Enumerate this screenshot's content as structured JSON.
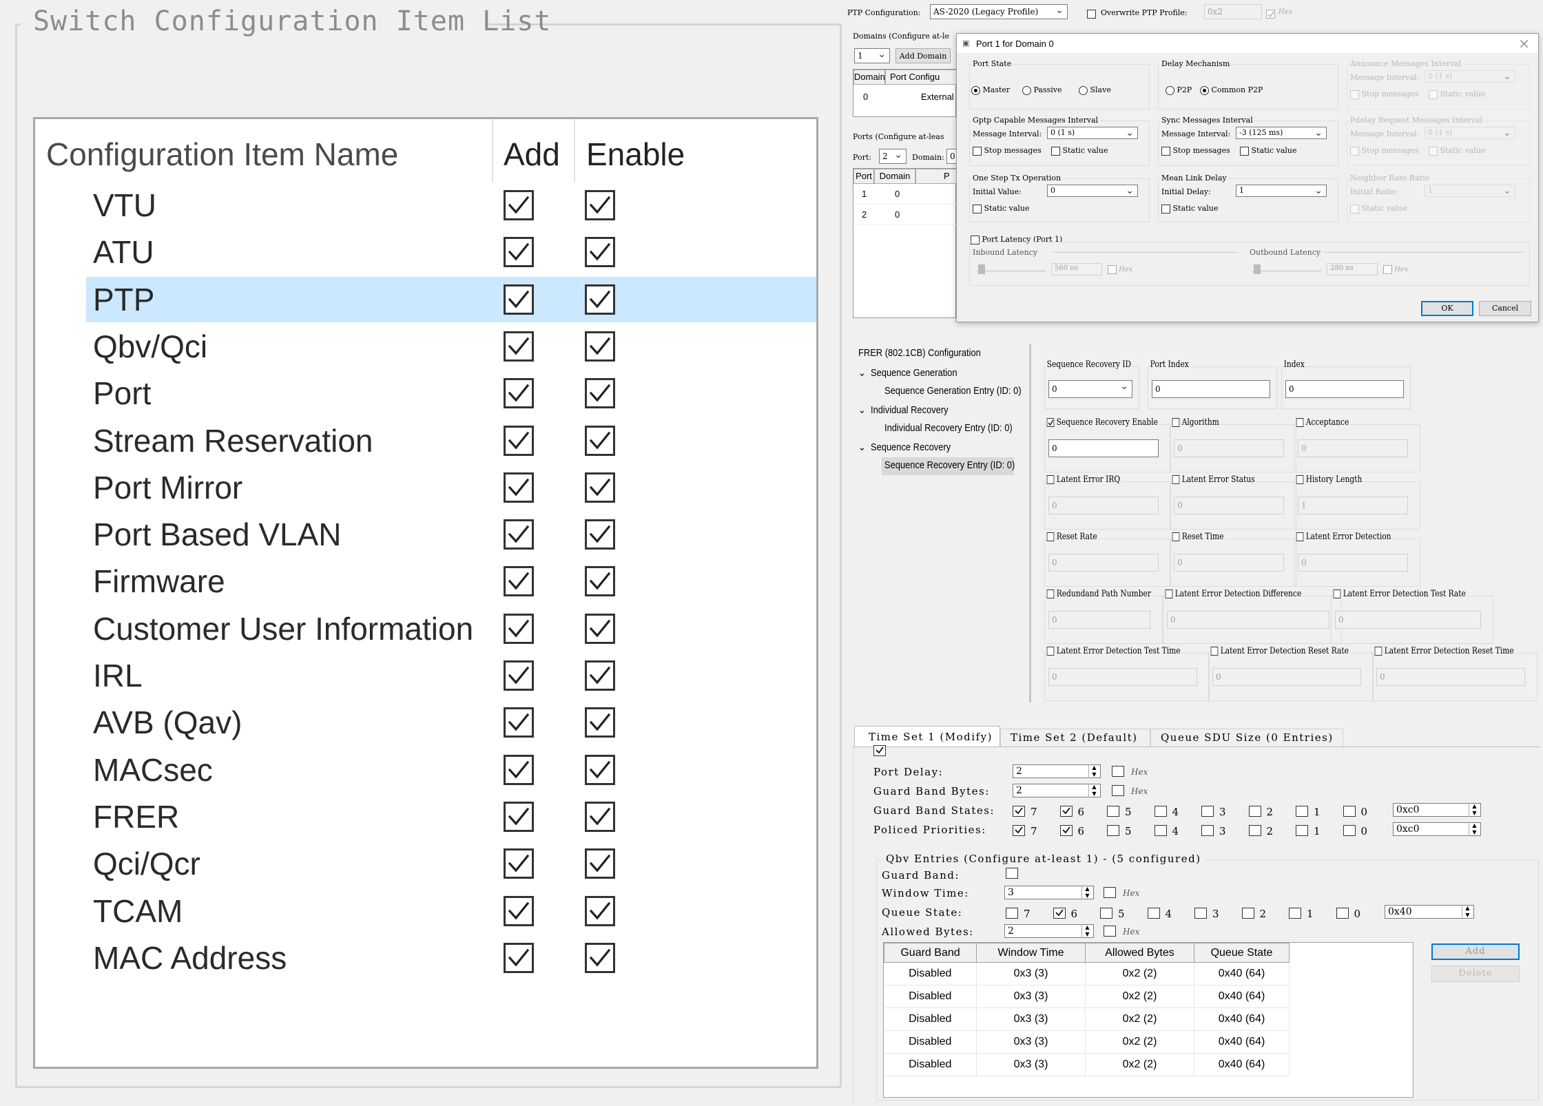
{
  "left": {
    "title": "Switch Configuration Item List",
    "headers": {
      "name": "Configuration Item Name",
      "add": "Add",
      "enable": "Enable"
    },
    "items": [
      {
        "label": "VTU",
        "add": true,
        "enable": true
      },
      {
        "label": "ATU",
        "add": true,
        "enable": true
      },
      {
        "label": "PTP",
        "add": true,
        "enable": true,
        "selected": true
      },
      {
        "label": "Qbv/Qci",
        "add": true,
        "enable": true
      },
      {
        "label": "Port",
        "add": true,
        "enable": true
      },
      {
        "label": "Stream Reservation",
        "add": true,
        "enable": true
      },
      {
        "label": "Port Mirror",
        "add": true,
        "enable": true
      },
      {
        "label": "Port Based VLAN",
        "add": true,
        "enable": true
      },
      {
        "label": "Firmware",
        "add": true,
        "enable": true
      },
      {
        "label": "Customer User Information",
        "add": true,
        "enable": true
      },
      {
        "label": "IRL",
        "add": true,
        "enable": true
      },
      {
        "label": "AVB (Qav)",
        "add": true,
        "enable": true
      },
      {
        "label": "MACsec",
        "add": true,
        "enable": true
      },
      {
        "label": "FRER",
        "add": true,
        "enable": true
      },
      {
        "label": "Qci/Qcr",
        "add": true,
        "enable": true
      },
      {
        "label": "TCAM",
        "add": true,
        "enable": true
      },
      {
        "label": "MAC Address",
        "add": true,
        "enable": true
      }
    ]
  },
  "ptp": {
    "config_label": "PTP Configuration:",
    "config_value": "AS-2020 (Legacy Profile)",
    "overwrite_label": "Overwrite PTP Profile:",
    "overwrite_value": "0x2",
    "hex_label": "Hex",
    "domains_label": "Domains (Configure at-le",
    "domain_select": "1",
    "add_domain": "Add Domain",
    "domain_table": {
      "headers": [
        "Domain",
        "Port Configu"
      ],
      "rows": [
        [
          "0",
          "External"
        ]
      ]
    },
    "ports_label": "Ports (Configure at-leas",
    "port_label": "Port:",
    "port_value": "2",
    "domain_lbl": "Domain:",
    "domain_value": "0",
    "port_table": {
      "headers": [
        "Port",
        "Domain",
        "P"
      ],
      "rows": [
        [
          "1",
          "0"
        ],
        [
          "2",
          "0"
        ]
      ]
    }
  },
  "dialog": {
    "title": "Port 1 for Domain 0",
    "close": "×",
    "port_state": {
      "title": "Port State",
      "options": [
        "Master",
        "Passive",
        "Slave"
      ],
      "selected": "Master"
    },
    "delay_mech": {
      "title": "Delay Mechanism",
      "options": [
        "P2P",
        "Common P2P"
      ],
      "selected": "Common P2P"
    },
    "announce": {
      "title": "Announce Messages Interval",
      "label": "Message Interval:",
      "value": "0 (1 s)",
      "stop": "Stop messages",
      "static": "Static value"
    },
    "gptp": {
      "title": "Gptp Capable Messages Interval",
      "label": "Message Interval:",
      "value": "0 (1 s)",
      "stop": "Stop messages",
      "static": "Static value"
    },
    "sync": {
      "title": "Sync Messages Interval",
      "label": "Message Interval:",
      "value": "-3 (125 ms)",
      "stop": "Stop messages",
      "static": "Static value"
    },
    "pdelay": {
      "title": "Pdelay Request Messages Interval",
      "label": "Message Interval:",
      "value": "0 (1 s)",
      "stop": "Stop messages",
      "static": "Static value"
    },
    "onestep": {
      "title": "One Step Tx Operation",
      "label": "Initial Value:",
      "value": "0",
      "static": "Static value"
    },
    "meanlink": {
      "title": "Mean Link Delay",
      "label": "Initial Delay:",
      "value": "1",
      "static": "Static value"
    },
    "neighbor": {
      "title": "Neighbor Rate Ratio",
      "label": "Initial Ratio:",
      "value": "1",
      "static": "Static value"
    },
    "latency": {
      "title": "Port Latency (Port 1)",
      "inbound": "Inbound Latency",
      "inbound_value": "560 ns",
      "outbound": "Outbound Latency",
      "outbound_value": "280 ns",
      "hex": "Hex"
    },
    "ok": "OK",
    "cancel": "Cancel"
  },
  "frer": {
    "tree": {
      "root": "FRER (802.1CB) Configuration",
      "nodes": [
        {
          "label": "Sequence Generation",
          "child": "Sequence Generation Entry (ID: 0)"
        },
        {
          "label": "Individual Recovery",
          "child": "Individual Recovery Entry (ID: 0)"
        },
        {
          "label": "Sequence Recovery",
          "child": "Sequence Recovery Entry (ID: 0)"
        }
      ]
    },
    "seq_recovery_id": {
      "label": "Sequence Recovery ID",
      "value": "0"
    },
    "port_index": {
      "label": "Port Index",
      "value": "0"
    },
    "index": {
      "label": "Index",
      "value": "0"
    },
    "fields": [
      {
        "label": "Sequence Recovery Enable",
        "value": "0",
        "checked": true,
        "enabled": true
      },
      {
        "label": "Algorithm",
        "value": "0",
        "checked": false
      },
      {
        "label": "Acceptance",
        "value": "0",
        "checked": false
      },
      {
        "label": "Latent Error IRQ",
        "value": "0",
        "checked": false
      },
      {
        "label": "Latent Error Status",
        "value": "0",
        "checked": false
      },
      {
        "label": "History Length",
        "value": "1",
        "checked": false
      },
      {
        "label": "Reset Rate",
        "value": "0",
        "checked": false
      },
      {
        "label": "Reset Time",
        "value": "0",
        "checked": false
      },
      {
        "label": "Latent Error Detection",
        "value": "0",
        "checked": false
      },
      {
        "label": "Redundand Path Number",
        "value": "0",
        "checked": false
      },
      {
        "label": "Latent Error Detection Difference",
        "value": "0",
        "checked": false
      },
      {
        "label": "Latent Error Detection Test Rate",
        "value": "0",
        "checked": false
      },
      {
        "label": "Latent Error Detection Test Time",
        "value": "0",
        "checked": false
      },
      {
        "label": "Latent Error Detection Reset Rate",
        "value": "0",
        "checked": false
      },
      {
        "label": "Latent Error Detection Reset Time",
        "value": "0",
        "checked": false
      }
    ]
  },
  "timeset": {
    "tabs": [
      "Time Set 1 (Modify)",
      "Time Set 2 (Default)",
      "Queue SDU Size (0 Entries)"
    ],
    "port_delay": {
      "label": "Port Delay:",
      "value": "2"
    },
    "guard_band_bytes": {
      "label": "Guard Band Bytes:",
      "value": "2"
    },
    "hex": "Hex",
    "guard_band_states": {
      "label": "Guard Band States:",
      "checked": [
        "7",
        "6"
      ],
      "value": "0xc0"
    },
    "policed_priorities": {
      "label": "Policed Priorities:",
      "checked": [
        "7",
        "6"
      ],
      "value": "0xc0"
    },
    "bits": [
      "7",
      "6",
      "5",
      "4",
      "3",
      "2",
      "1",
      "0"
    ],
    "qbv": {
      "title": "Qbv Entries (Configure at-least 1) - (5 configured)",
      "guard_band": "Guard Band:",
      "window_time": {
        "label": "Window Time:",
        "value": "3"
      },
      "queue_state": {
        "label": "Queue State:",
        "checked": [
          "6"
        ],
        "value": "0x40"
      },
      "allowed_bytes": {
        "label": "Allowed Bytes:",
        "value": "2"
      },
      "add": "Add",
      "delete": "Delete",
      "table": {
        "headers": [
          "Guard Band",
          "Window Time",
          "Allowed Bytes",
          "Queue State"
        ],
        "rows": [
          [
            "Disabled",
            "0x3 (3)",
            "0x2 (2)",
            "0x40 (64)"
          ],
          [
            "Disabled",
            "0x3 (3)",
            "0x2 (2)",
            "0x40 (64)"
          ],
          [
            "Disabled",
            "0x3 (3)",
            "0x2 (2)",
            "0x40 (64)"
          ],
          [
            "Disabled",
            "0x3 (3)",
            "0x2 (2)",
            "0x40 (64)"
          ],
          [
            "Disabled",
            "0x3 (3)",
            "0x2 (2)",
            "0x40 (64)"
          ]
        ]
      }
    }
  },
  "colors": {
    "selected_row": "#cce8ff",
    "accent": "#0078d7",
    "window_bg": "#f0f0f0"
  }
}
